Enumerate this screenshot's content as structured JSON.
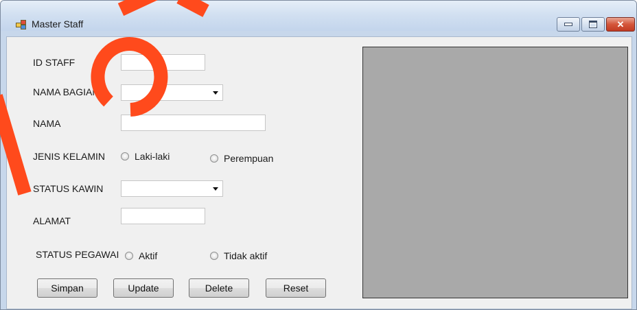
{
  "window": {
    "title": "Master Staff",
    "controls": {
      "minimize": "minimize",
      "maximize": "maximize",
      "close": "close"
    }
  },
  "form": {
    "id_staff_label": "ID STAFF",
    "nama_bagian_label": "NAMA BAGIAN",
    "nama_label": "NAMA",
    "jenis_kelamin_label": "JENIS KELAMIN",
    "gender_options": [
      "Laki-laki",
      "Perempuan"
    ],
    "status_kawin_label": "STATUS KAWIN",
    "alamat_label": "ALAMAT",
    "status_pegawai_label": "STATUS PEGAWAI",
    "status_options": [
      "Aktif",
      "Tidak aktif"
    ],
    "id_staff_value": "",
    "nama_bagian_value": "",
    "nama_value": "",
    "status_kawin_value": "",
    "alamat_value": ""
  },
  "buttons": {
    "simpan": "Simpan",
    "update": "Update",
    "delete": "Delete",
    "reset": "Reset"
  },
  "colors": {
    "picture_box": "#a9a9a9",
    "watermark": "#ff4a1c"
  }
}
